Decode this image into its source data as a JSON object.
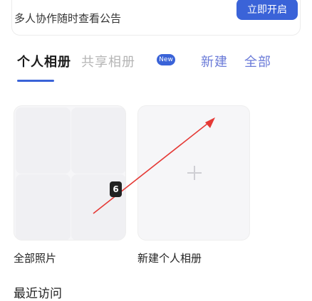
{
  "promo": {
    "title": "",
    "subtitle": "多人协作随时查看公告",
    "action_label": "立即开启"
  },
  "tabs": [
    {
      "label": "个人相册"
    },
    {
      "label": "共享相册"
    },
    {
      "label": "新建"
    },
    {
      "label": "全部"
    }
  ],
  "new_badge": "New",
  "albums": {
    "all_label": "全部照片",
    "new_label": "新建个人相册",
    "recent_label": "最近访问"
  },
  "marker": "6",
  "colors": {
    "accent": "#3a63d8",
    "annotation": "#e53935"
  }
}
